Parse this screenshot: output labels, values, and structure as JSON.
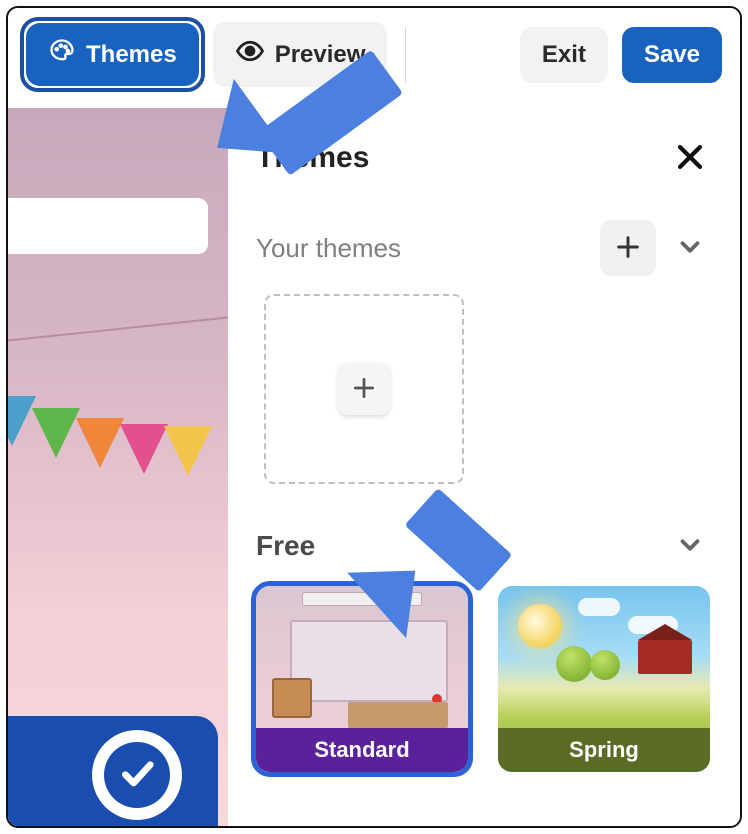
{
  "toolbar": {
    "themes_label": "Themes",
    "preview_label": "Preview",
    "exit_label": "Exit",
    "save_label": "Save"
  },
  "panel": {
    "title": "Themes",
    "sections": {
      "your_themes": {
        "label": "Your themes"
      },
      "free": {
        "label": "Free",
        "items": [
          {
            "name": "Standard",
            "selected": true
          },
          {
            "name": "Spring",
            "selected": false
          }
        ]
      }
    }
  }
}
